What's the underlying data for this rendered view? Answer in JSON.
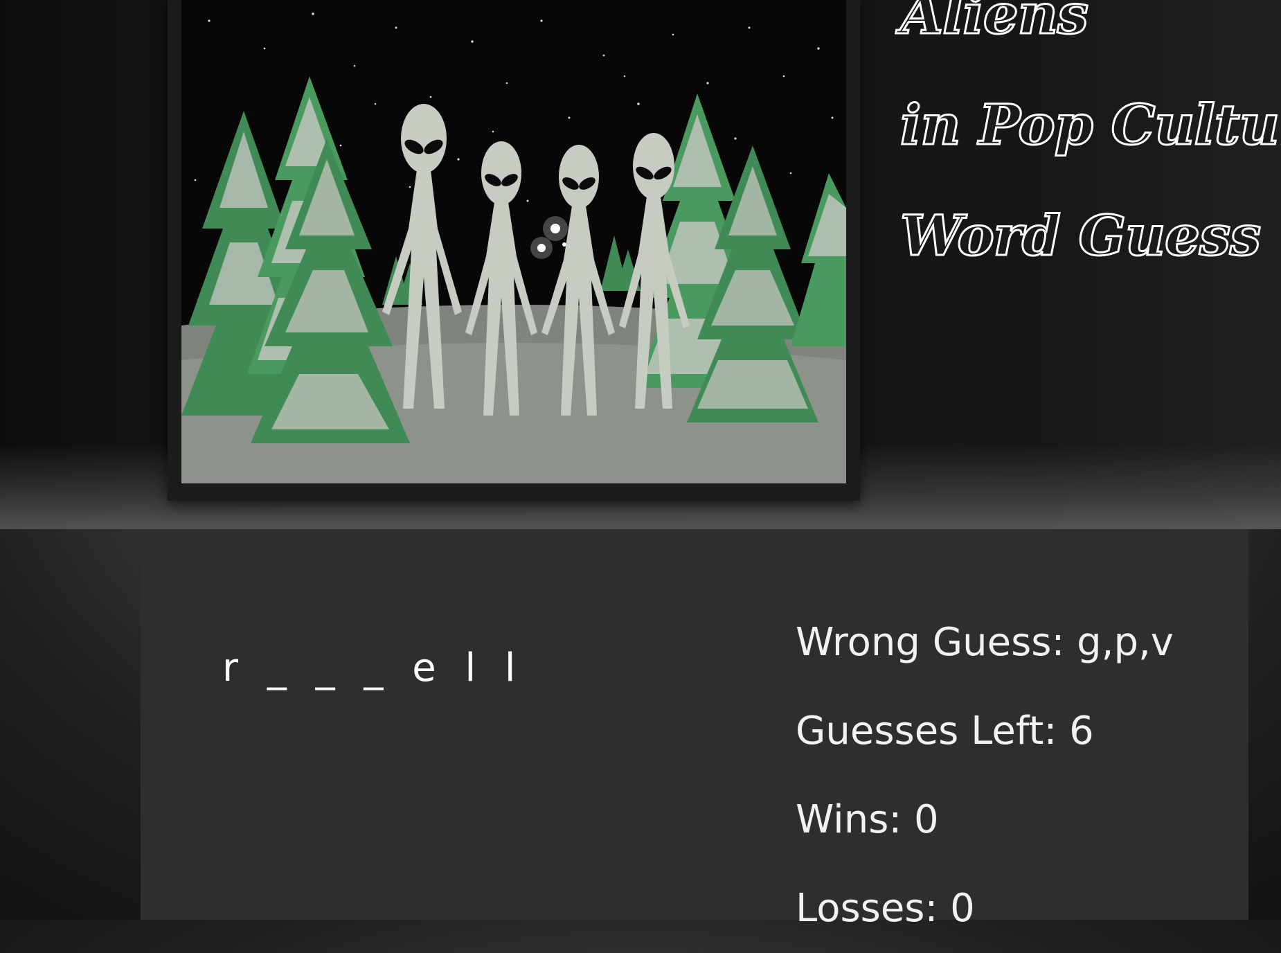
{
  "title": {
    "line1": "Aliens",
    "line2": "in Pop Culture",
    "line3": "Word Guess"
  },
  "image": {
    "description_icon": "aliens-in-snowy-forest-image"
  },
  "game": {
    "word": "r _ _ _ e l l",
    "wrong_guess_label": "Wrong Guess: g,p,v",
    "guesses_left_label": "Guesses Left: 6",
    "wins_label": "Wins: 0",
    "losses_label": "Losses: 0"
  },
  "colors": {
    "panel": "#2e2e2e",
    "text": "#ffffff",
    "tree_green": "#3f8a55",
    "snow": "#b9c0b8",
    "alien": "#c6ccc2"
  }
}
